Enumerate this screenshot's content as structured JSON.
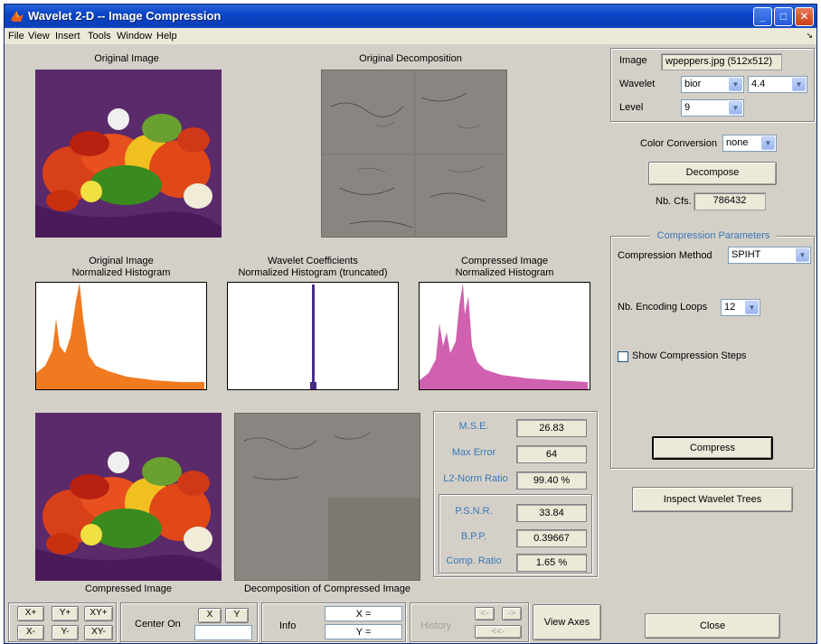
{
  "window": {
    "title": "Wavelet 2-D -- Image Compression",
    "controls": [
      "_",
      "□",
      "✕"
    ]
  },
  "menu": [
    "File",
    "View",
    "Insert",
    "Tools",
    "Window",
    "Help"
  ],
  "captions": {
    "original_image": "Original Image",
    "original_decomposition": "Original Decomposition",
    "hist_original_l1": "Original Image",
    "hist_original_l2": "Normalized Histogram",
    "hist_coeffs_l1": "Wavelet Coefficients",
    "hist_coeffs_l2": "Normalized Histogram (truncated)",
    "hist_compressed_l1": "Compressed Image",
    "hist_compressed_l2": "Normalized Histogram",
    "compressed_image": "Compressed Image",
    "decomposition_compressed": "Decomposition of Compressed Image"
  },
  "stats": {
    "mse_label": "M.S.E.",
    "mse": "26.83",
    "maxerr_label": "Max Error",
    "maxerr": "64",
    "l2_label": "L2-Norm Ratio",
    "l2": "99.40 %",
    "psnr_label": "P.S.N.R.",
    "psnr": "33.84",
    "bpp_label": "B.P.P.",
    "bpp": "0.39667",
    "ratio_label": "Comp. Ratio",
    "ratio": "1.65 %"
  },
  "right": {
    "image_label": "Image",
    "image_value": "wpeppers.jpg  (512x512)",
    "wavelet_label": "Wavelet",
    "wavelet_family": "bior",
    "wavelet_number": "4.4",
    "level_label": "Level",
    "level_value": "9",
    "color_conv_label": "Color Conversion",
    "color_conv_value": "none",
    "decompose": "Decompose",
    "nbcfs_label": "Nb. Cfs.",
    "nbcfs_value": "786432",
    "comp_params_title": "Compression Parameters",
    "comp_method_label": "Compression Method",
    "comp_method_value": "SPIHT",
    "loops_label": "Nb. Encoding Loops",
    "loops_value": "12",
    "show_steps": "Show Compression Steps",
    "compress": "Compress",
    "inspect": "Inspect Wavelet Trees",
    "close": "Close"
  },
  "bottom": {
    "xplus": "X+",
    "yplus": "Y+",
    "xyplus": "XY+",
    "xminus": "X-",
    "yminus": "Y-",
    "xyminus": "XY-",
    "center_on": "Center On",
    "x_btn": "X",
    "y_btn": "Y",
    "info": "Info",
    "x_eq": "X =",
    "y_eq": "Y =",
    "history": "History",
    "hist_back": "<-",
    "hist_fwd": "->",
    "hist_first": "<<-",
    "view_axes": "View Axes"
  },
  "colors": {
    "orig_hist": "#f07a20",
    "coeff_hist": "#4a2a8a",
    "comp_hist": "#d060b0",
    "label_blue": "#3a78b8"
  }
}
